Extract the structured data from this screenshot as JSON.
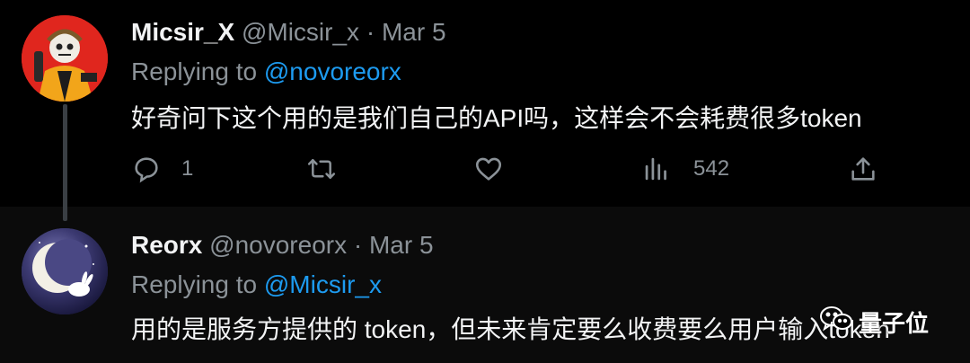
{
  "tweets": [
    {
      "author_name": "Micsir_X",
      "handle": "@Micsir_x",
      "separator": "·",
      "date": "Mar 5",
      "replying_prefix": "Replying to",
      "replying_to": "@novoreorx",
      "text": "好奇问下这个用的是我们自己的API吗，这样会不会耗费很多token",
      "actions": {
        "reply_count": "1",
        "views_count": "542"
      }
    },
    {
      "author_name": "Reorx",
      "handle": "@novoreorx",
      "separator": "·",
      "date": "Mar 5",
      "replying_prefix": "Replying to",
      "replying_to": "@Micsir_x",
      "text": "用的是服务方提供的 token，但未来肯定要么收费要么用户输入token"
    }
  ],
  "watermark": {
    "text": "量子位"
  },
  "colors": {
    "background": "#000000",
    "accent": "#1d9bf0",
    "muted": "#8b9298"
  }
}
